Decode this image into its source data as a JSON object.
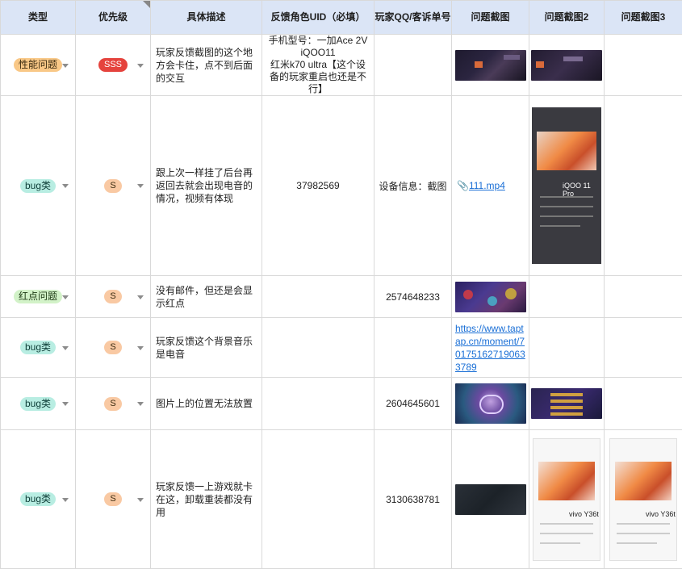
{
  "headers": {
    "type": "类型",
    "priority": "优先级",
    "description": "具体描述",
    "uid": "反馈角色UID（必填）",
    "qq": "玩家QQ/客诉单号",
    "shot1": "问题截图",
    "shot2": "问题截图2",
    "shot3": "问题截图3"
  },
  "rows": [
    {
      "type": "性能问题",
      "type_bg": "#f9c887",
      "type_fg": "#3a2a10",
      "priority": "SSS",
      "priority_bg": "#e5433d",
      "priority_fg": "#ffffff",
      "description": "玩家反馈截图的这个地方会卡住，点不到后面的交互",
      "uid_lines": [
        "手机型号：一加Ace 2V",
        "iQOO11",
        "红米k70 ultra【这个设备的玩家重启也还是不行】"
      ],
      "qq": ""
    },
    {
      "type": "bug类",
      "type_bg": "#b8ede2",
      "type_fg": "#10403a",
      "priority": "S",
      "priority_bg": "#f9c9a3",
      "priority_fg": "#3a2a10",
      "description": "跟上次一样挂了后台再返回去就会出现电音的情况，视频有体现",
      "uid": "37982569",
      "qq": "设备信息：截图",
      "attachment": "111.mp4",
      "phone2_title": "iQOO 11 Pro"
    },
    {
      "type": "红点问题",
      "type_bg": "#d2f2c8",
      "type_fg": "#1d3a14",
      "priority": "S",
      "priority_bg": "#f9c9a3",
      "priority_fg": "#3a2a10",
      "description": "没有邮件，但还是会显示红点",
      "uid": "",
      "qq": "2574648233"
    },
    {
      "type": "bug类",
      "type_bg": "#b8ede2",
      "type_fg": "#10403a",
      "priority": "S",
      "priority_bg": "#f9c9a3",
      "priority_fg": "#3a2a10",
      "description": "玩家反馈这个背景音乐是电音",
      "uid": "",
      "qq": "",
      "link": "https://www.taptap.cn/moment/701751627190633789"
    },
    {
      "type": "bug类",
      "type_bg": "#b8ede2",
      "type_fg": "#10403a",
      "priority": "S",
      "priority_bg": "#f9c9a3",
      "priority_fg": "#3a2a10",
      "description": "图片上的位置无法放置",
      "uid": "",
      "qq": "2604645601"
    },
    {
      "type": "bug类",
      "type_bg": "#b8ede2",
      "type_fg": "#10403a",
      "priority": "S",
      "priority_bg": "#f9c9a3",
      "priority_fg": "#3a2a10",
      "description": "玩家反馈一上游戏就卡在这，卸载重装都没有用",
      "uid": "",
      "qq": "3130638781",
      "phone_title": "vivo Y36t"
    }
  ]
}
